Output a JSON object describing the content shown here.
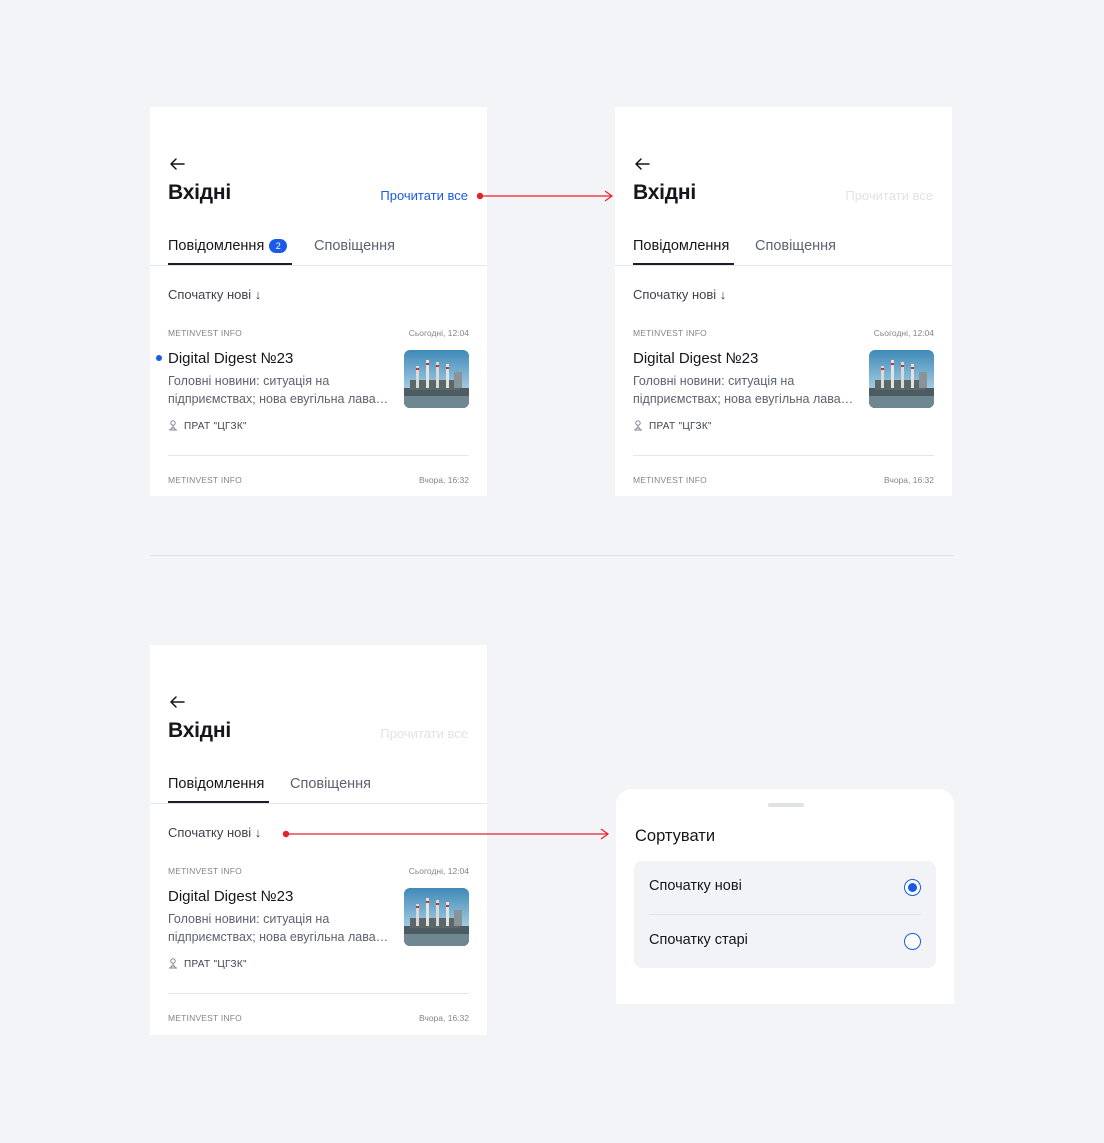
{
  "screen": {
    "title": "Вхідні",
    "read_all": "Прочитати все",
    "tabs": {
      "messages": "Повідомлення",
      "notifications": "Сповіщення",
      "unread_count": "2"
    },
    "sort_label": "Спочатку нові ↓",
    "items": [
      {
        "source": "METINVEST INFO",
        "time": "Сьогодні, 12:04",
        "title": "Digital Digest №23",
        "desc_line1": "Головні новини: ситуація на",
        "desc_line2": "підприємствах; нова евугільна лава…",
        "company": "ПРАТ \"ЦГЗК\""
      },
      {
        "source": "METINVEST INFO",
        "time": "Вчора, 16:32"
      }
    ]
  },
  "sort_sheet": {
    "title": "Сортувати",
    "options": [
      "Спочатку нові",
      "Спочатку старі"
    ],
    "selected": "Спочатку нові"
  },
  "colors": {
    "accent": "#1a5ae6",
    "annotation_arrow": "#e8202a",
    "background": "#f2f4f7"
  },
  "icons": [
    "back-arrow-icon",
    "company-icon",
    "radio-selected-icon",
    "radio-empty-icon"
  ]
}
